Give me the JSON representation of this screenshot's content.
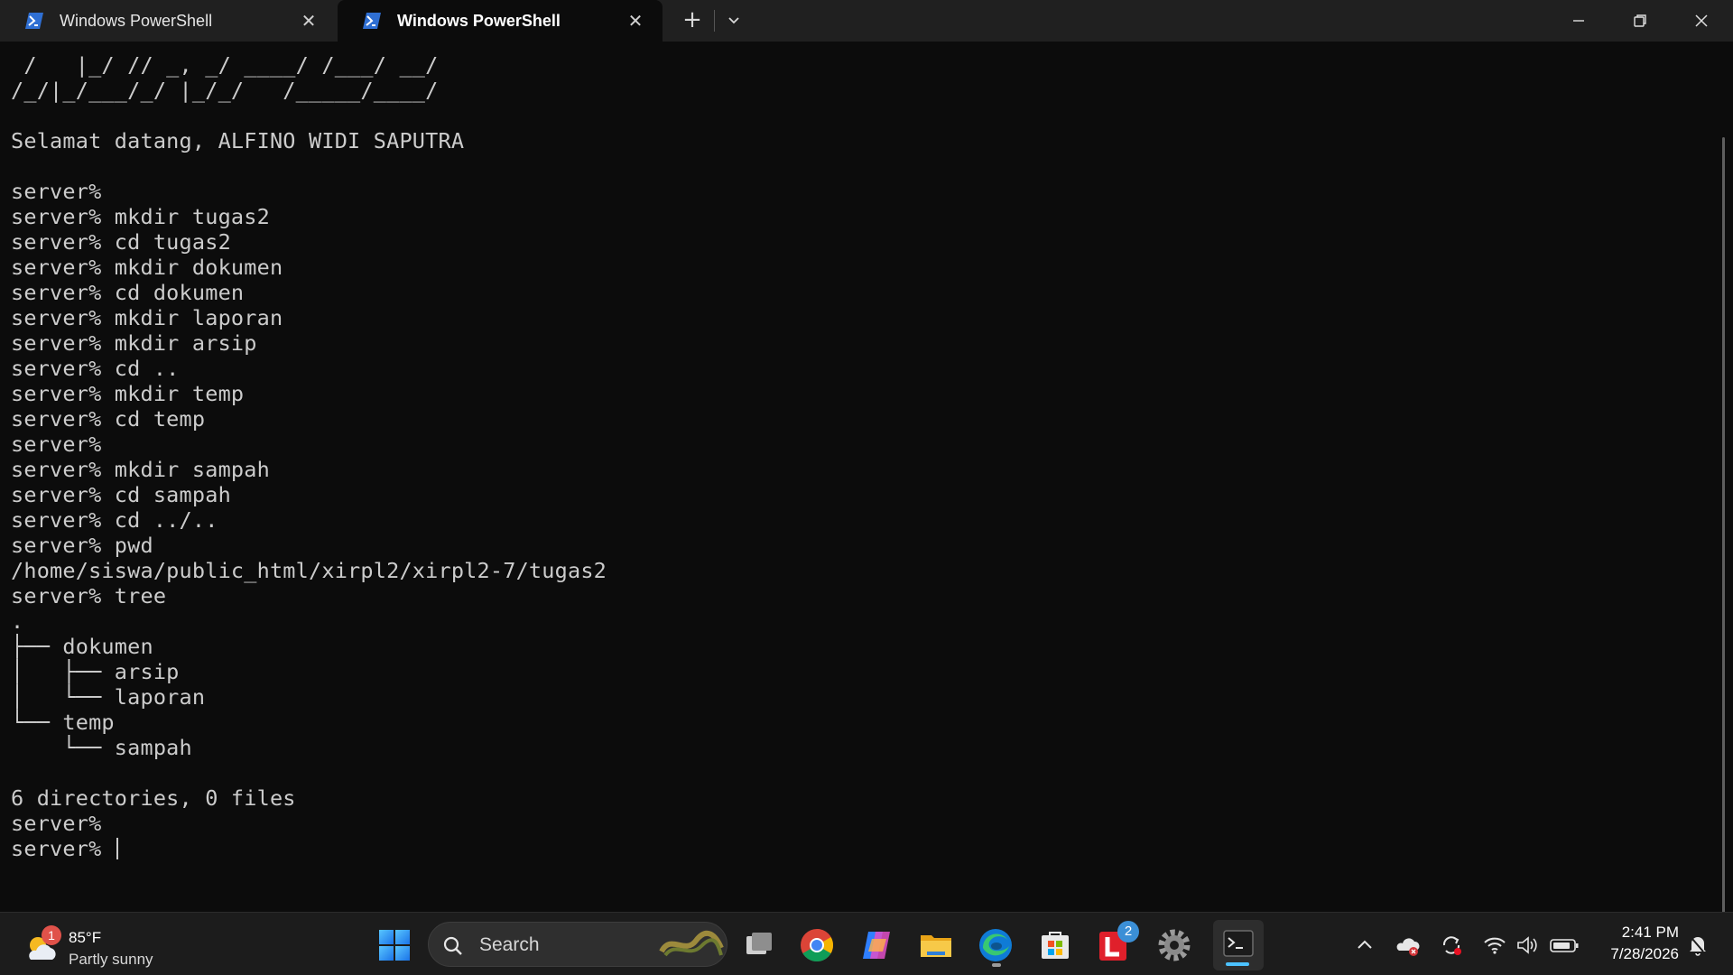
{
  "tabs": [
    {
      "title": "Windows PowerShell",
      "active": false
    },
    {
      "title": "Windows PowerShell",
      "active": true
    }
  ],
  "terminal": {
    "lines": [
      " /   |_/ // _, _/ ____/ /___/ __/",
      "/_/|_/___/_/ |_/_/   /_____/____/",
      "",
      "Selamat datang, ALFINO WIDI SAPUTRA",
      "",
      "server%",
      "server% mkdir tugas2",
      "server% cd tugas2",
      "server% mkdir dokumen",
      "server% cd dokumen",
      "server% mkdir laporan",
      "server% mkdir arsip",
      "server% cd ..",
      "server% mkdir temp",
      "server% cd temp",
      "server%",
      "server% mkdir sampah",
      "server% cd sampah",
      "server% cd ../..",
      "server% pwd",
      "/home/siswa/public_html/xirpl2/xirpl2-7/tugas2",
      "server% tree",
      ".",
      "├── dokumen",
      "│   ├── arsip",
      "│   └── laporan",
      "└── temp",
      "    └── sampah",
      "",
      "6 directories, 0 files",
      "server%"
    ],
    "prompt": "server% "
  },
  "taskbar": {
    "weather": {
      "temp": "85°F",
      "desc": "Partly sunny",
      "badge": "1"
    },
    "search_label": "Search",
    "apps": [
      {
        "name": "task-view",
        "icon": "task-view-icon"
      },
      {
        "name": "chrome",
        "icon": "chrome-icon"
      },
      {
        "name": "copilot",
        "icon": "copilot-icon"
      },
      {
        "name": "file-explorer",
        "icon": "folder-icon"
      },
      {
        "name": "edge",
        "icon": "edge-icon"
      },
      {
        "name": "microsoft-store",
        "icon": "store-icon"
      },
      {
        "name": "l-app",
        "icon": "l-app-icon",
        "badge": "2"
      },
      {
        "name": "settings",
        "icon": "gear-icon"
      },
      {
        "name": "terminal",
        "icon": "terminal-icon"
      }
    ],
    "clock": {
      "time": "2:41 PM",
      "date": "7/28/2026"
    }
  },
  "colors": {
    "terminal_bg": "#0c0c0c",
    "terminal_fg": "#cccccc",
    "titlebar_bg": "#202020",
    "taskbar_bg": "#1c1c1c",
    "accent": "#4cc2ff"
  }
}
